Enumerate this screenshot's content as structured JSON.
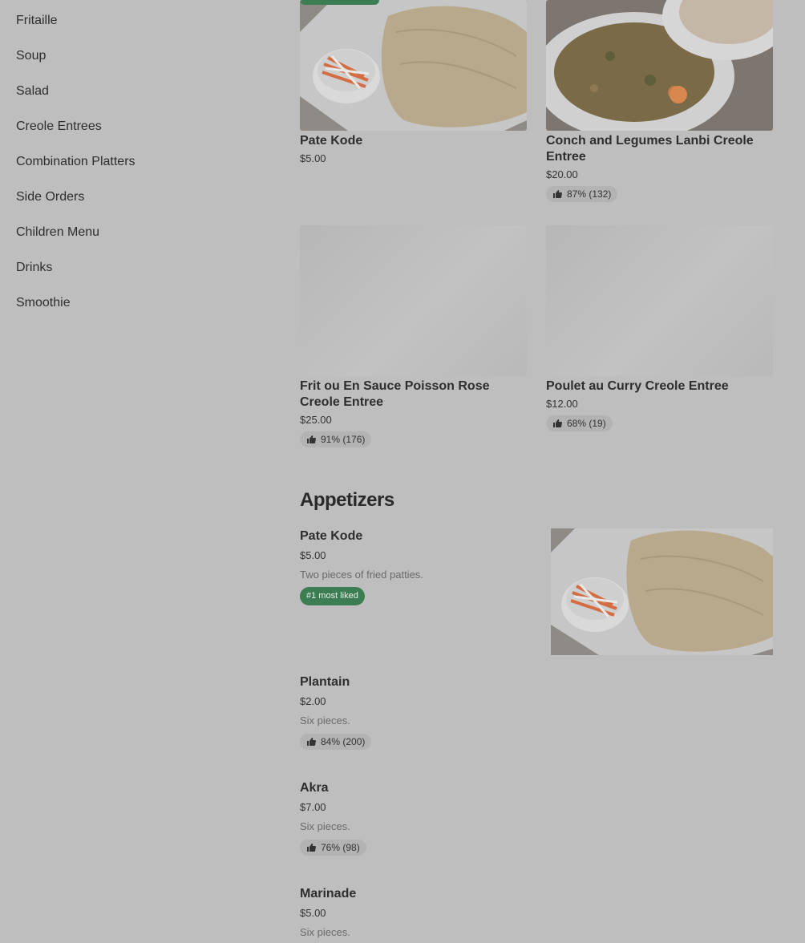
{
  "sidebar": {
    "items": [
      {
        "label": "Fritaille"
      },
      {
        "label": "Soup"
      },
      {
        "label": "Salad"
      },
      {
        "label": "Creole Entrees"
      },
      {
        "label": "Combination Platters"
      },
      {
        "label": "Side Orders"
      },
      {
        "label": "Children Menu"
      },
      {
        "label": "Drinks"
      },
      {
        "label": "Smoothie"
      }
    ]
  },
  "featured": [
    {
      "title": "Pate Kode",
      "price": "$5.00"
    },
    {
      "title": "Conch and Legumes Lanbi Creole Entree",
      "price": "$20.00",
      "rating": "87% (132)"
    },
    {
      "title": "Frit ou En Sauce Poisson Rose Creole Entree",
      "price": "$25.00",
      "rating": "91% (176)"
    },
    {
      "title": "Poulet au Curry Creole Entree",
      "price": "$12.00",
      "rating": "68% (19)"
    }
  ],
  "appetizers": {
    "title": "Appetizers",
    "items": [
      {
        "name": "Pate Kode",
        "price": "$5.00",
        "description": "Two pieces of fried patties.",
        "badge": "#1 most liked"
      },
      {
        "name": "Plantain",
        "price": "$2.00",
        "description": "Six pieces.",
        "rating": "84% (200)"
      },
      {
        "name": "Akra",
        "price": "$7.00",
        "description": "Six pieces.",
        "rating": "76% (98)"
      },
      {
        "name": "Marinade",
        "price": "$5.00",
        "description": "Six pieces."
      }
    ]
  },
  "icons": {
    "rating": "thumbs-up-icon"
  },
  "colors": {
    "background": "#bebebe",
    "badge": "#3d7d54"
  }
}
